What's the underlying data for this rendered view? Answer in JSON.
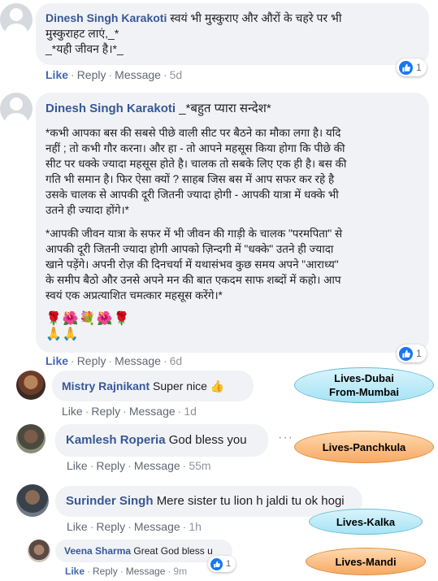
{
  "comments": [
    {
      "author": "Dinesh Singh Karakoti",
      "line1": "स्वयं भी मुस्कुराए और औरों के चहरे पर भी",
      "line2": "मुस्कुराहट लाएं,_*",
      "line3": "_*यही जीवन है।*_",
      "like": "Like",
      "reply": "Reply",
      "message": "Message",
      "time": "5d",
      "reaction_count": "1"
    },
    {
      "author": "Dinesh Singh Karakoti",
      "intro": "_*बहुत प्यारा सन्देश*",
      "para1": [
        "*कभी आपका बस की सबसे पीछे वाली सीट पर बैठने का मौका लगा है। यदि",
        "नहीं ; तो कभी गौर करना। और हा - तो आपने महसूस किया होगा कि पीछे की",
        "सीट पर धक्के ज्यादा महसूस होते है। चालक तो सबके लिए एक ही है। बस की",
        "गति भी समान है। फिर ऐसा क्यों ? साहब जिस बस में आप सफर कर रहे है",
        "उसके चालक से आपकी दूरी जितनी ज्यादा होगी - आपकी यात्रा में धक्के भी",
        "उतने ही ज्यादा होंगे।*"
      ],
      "para2": [
        "*आपकी जीवन यात्रा के सफर में भी जीवन की गाड़ी के चालक \"परमपिता\" से",
        "आपकी दूरी जितनी ज्यादा होगी आपको ज़िन्दगी में \"धक्के\" उतने ही ज्यादा",
        "खाने पड़ेंगे। अपनी रोज़ की दिनचर्या में यथासंभव कुछ समय अपने \"आराध्य\"",
        "के समीप बैठो और उनसे अपने मन की बात एकदम साफ शब्दों में कहो। आप",
        "स्वयं एक अप्रत्याशित चमत्कार महसूस करेंगे।*"
      ],
      "emoji_line1": "🌹🌺💐🌺🌹",
      "emoji_line2": "🙏🙏",
      "like": "Like",
      "reply": "Reply",
      "message": "Message",
      "time": "6d",
      "reaction_count": "1"
    }
  ],
  "replies": [
    {
      "author": "Mistry Rajnikant",
      "text": "Super nice 👍",
      "like": "Like",
      "reply": "Reply",
      "message": "Message",
      "time": "1d"
    },
    {
      "author": "Kamlesh Roperia",
      "text": "God bless you",
      "like": "Like",
      "reply": "Reply",
      "message": "Message",
      "time": "55m"
    },
    {
      "author": "Surinder Singh",
      "text": "Mere sister tu lion h jaldi tu ok hogi",
      "like": "Like",
      "reply": "Reply",
      "message": "Message",
      "time": "1h"
    },
    {
      "author": "Veena Sharma",
      "text": "Great God bless u",
      "like": "Like",
      "reply": "Reply",
      "message": "Message",
      "time": "9m",
      "reaction_count": "1"
    }
  ],
  "annotations": {
    "dubai_line1": "Lives-Dubai",
    "dubai_line2": "From-Mumbai",
    "panchkula": "Lives-Panchkula",
    "kalka": "Lives-Kalka",
    "mandi": "Lives-Mandi"
  },
  "icons": {
    "more": "more-options-icon",
    "like_reaction": "like-reaction-icon",
    "avatar": "default-avatar"
  },
  "colors": {
    "name": "#385898",
    "link": "#4267b2",
    "bubble": "#f0f2f5",
    "like_blue": "#1877f2",
    "tag_blue": "#a6e3f5",
    "tag_orange": "#f7a963"
  }
}
